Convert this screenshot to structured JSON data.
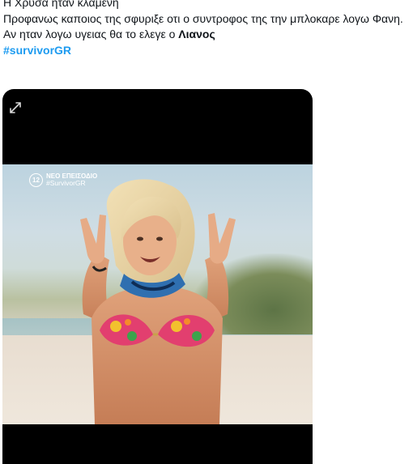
{
  "tweet": {
    "line1": "Η Χρυσα ηταν κλαμενη",
    "line2": "Προφανως καποιος της σφυριξε οτι ο συντροφος της την μπλοκαρε λογω Φανη.",
    "line3_prefix": "Αν ηταν λογω υγειας θα το ελεγε ο ",
    "line3_bold": "Λιανος",
    "hashtag": "#survivorGR"
  },
  "media": {
    "overlay_channel": "12",
    "overlay_title": "ΝΕΟ ΕΠΕΙΣΟΔΙΟ",
    "overlay_hashtag": "#SurvivorGR",
    "expand_icon": "expand-icon"
  }
}
